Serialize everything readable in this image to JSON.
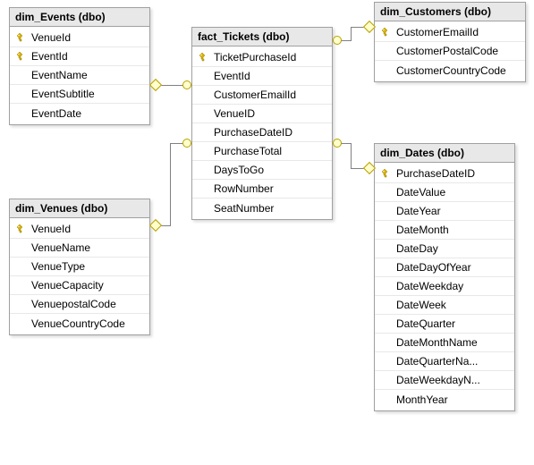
{
  "tables": {
    "events": {
      "title": "dim_Events (dbo)",
      "columns": [
        {
          "name": "VenueId",
          "pk": true
        },
        {
          "name": "EventId",
          "pk": true
        },
        {
          "name": "EventName",
          "pk": false
        },
        {
          "name": "EventSubtitle",
          "pk": false
        },
        {
          "name": "EventDate",
          "pk": false
        }
      ]
    },
    "tickets": {
      "title": "fact_Tickets (dbo)",
      "columns": [
        {
          "name": "TicketPurchaseId",
          "pk": true
        },
        {
          "name": "EventId",
          "pk": false
        },
        {
          "name": "CustomerEmailId",
          "pk": false
        },
        {
          "name": "VenueID",
          "pk": false
        },
        {
          "name": "PurchaseDateID",
          "pk": false
        },
        {
          "name": "PurchaseTotal",
          "pk": false
        },
        {
          "name": "DaysToGo",
          "pk": false
        },
        {
          "name": "RowNumber",
          "pk": false
        },
        {
          "name": "SeatNumber",
          "pk": false
        }
      ]
    },
    "customers": {
      "title": "dim_Customers (dbo)",
      "columns": [
        {
          "name": "CustomerEmailId",
          "pk": true
        },
        {
          "name": "CustomerPostalCode",
          "pk": false
        },
        {
          "name": "CustomerCountryCode",
          "pk": false
        }
      ]
    },
    "venues": {
      "title": "dim_Venues (dbo)",
      "columns": [
        {
          "name": "VenueId",
          "pk": true
        },
        {
          "name": "VenueName",
          "pk": false
        },
        {
          "name": "VenueType",
          "pk": false
        },
        {
          "name": "VenueCapacity",
          "pk": false
        },
        {
          "name": "VenuepostalCode",
          "pk": false
        },
        {
          "name": "VenueCountryCode",
          "pk": false
        }
      ]
    },
    "dates": {
      "title": "dim_Dates (dbo)",
      "columns": [
        {
          "name": "PurchaseDateID",
          "pk": true
        },
        {
          "name": "DateValue",
          "pk": false
        },
        {
          "name": "DateYear",
          "pk": false
        },
        {
          "name": "DateMonth",
          "pk": false
        },
        {
          "name": "DateDay",
          "pk": false
        },
        {
          "name": "DateDayOfYear",
          "pk": false
        },
        {
          "name": "DateWeekday",
          "pk": false
        },
        {
          "name": "DateWeek",
          "pk": false
        },
        {
          "name": "DateQuarter",
          "pk": false
        },
        {
          "name": "DateMonthName",
          "pk": false
        },
        {
          "name": "DateQuarterNa...",
          "pk": false
        },
        {
          "name": "DateWeekdayN...",
          "pk": false
        },
        {
          "name": "MonthYear",
          "pk": false
        }
      ]
    }
  },
  "relationships": [
    {
      "from": "tickets",
      "to": "events"
    },
    {
      "from": "tickets",
      "to": "customers"
    },
    {
      "from": "tickets",
      "to": "venues"
    },
    {
      "from": "tickets",
      "to": "dates"
    }
  ]
}
